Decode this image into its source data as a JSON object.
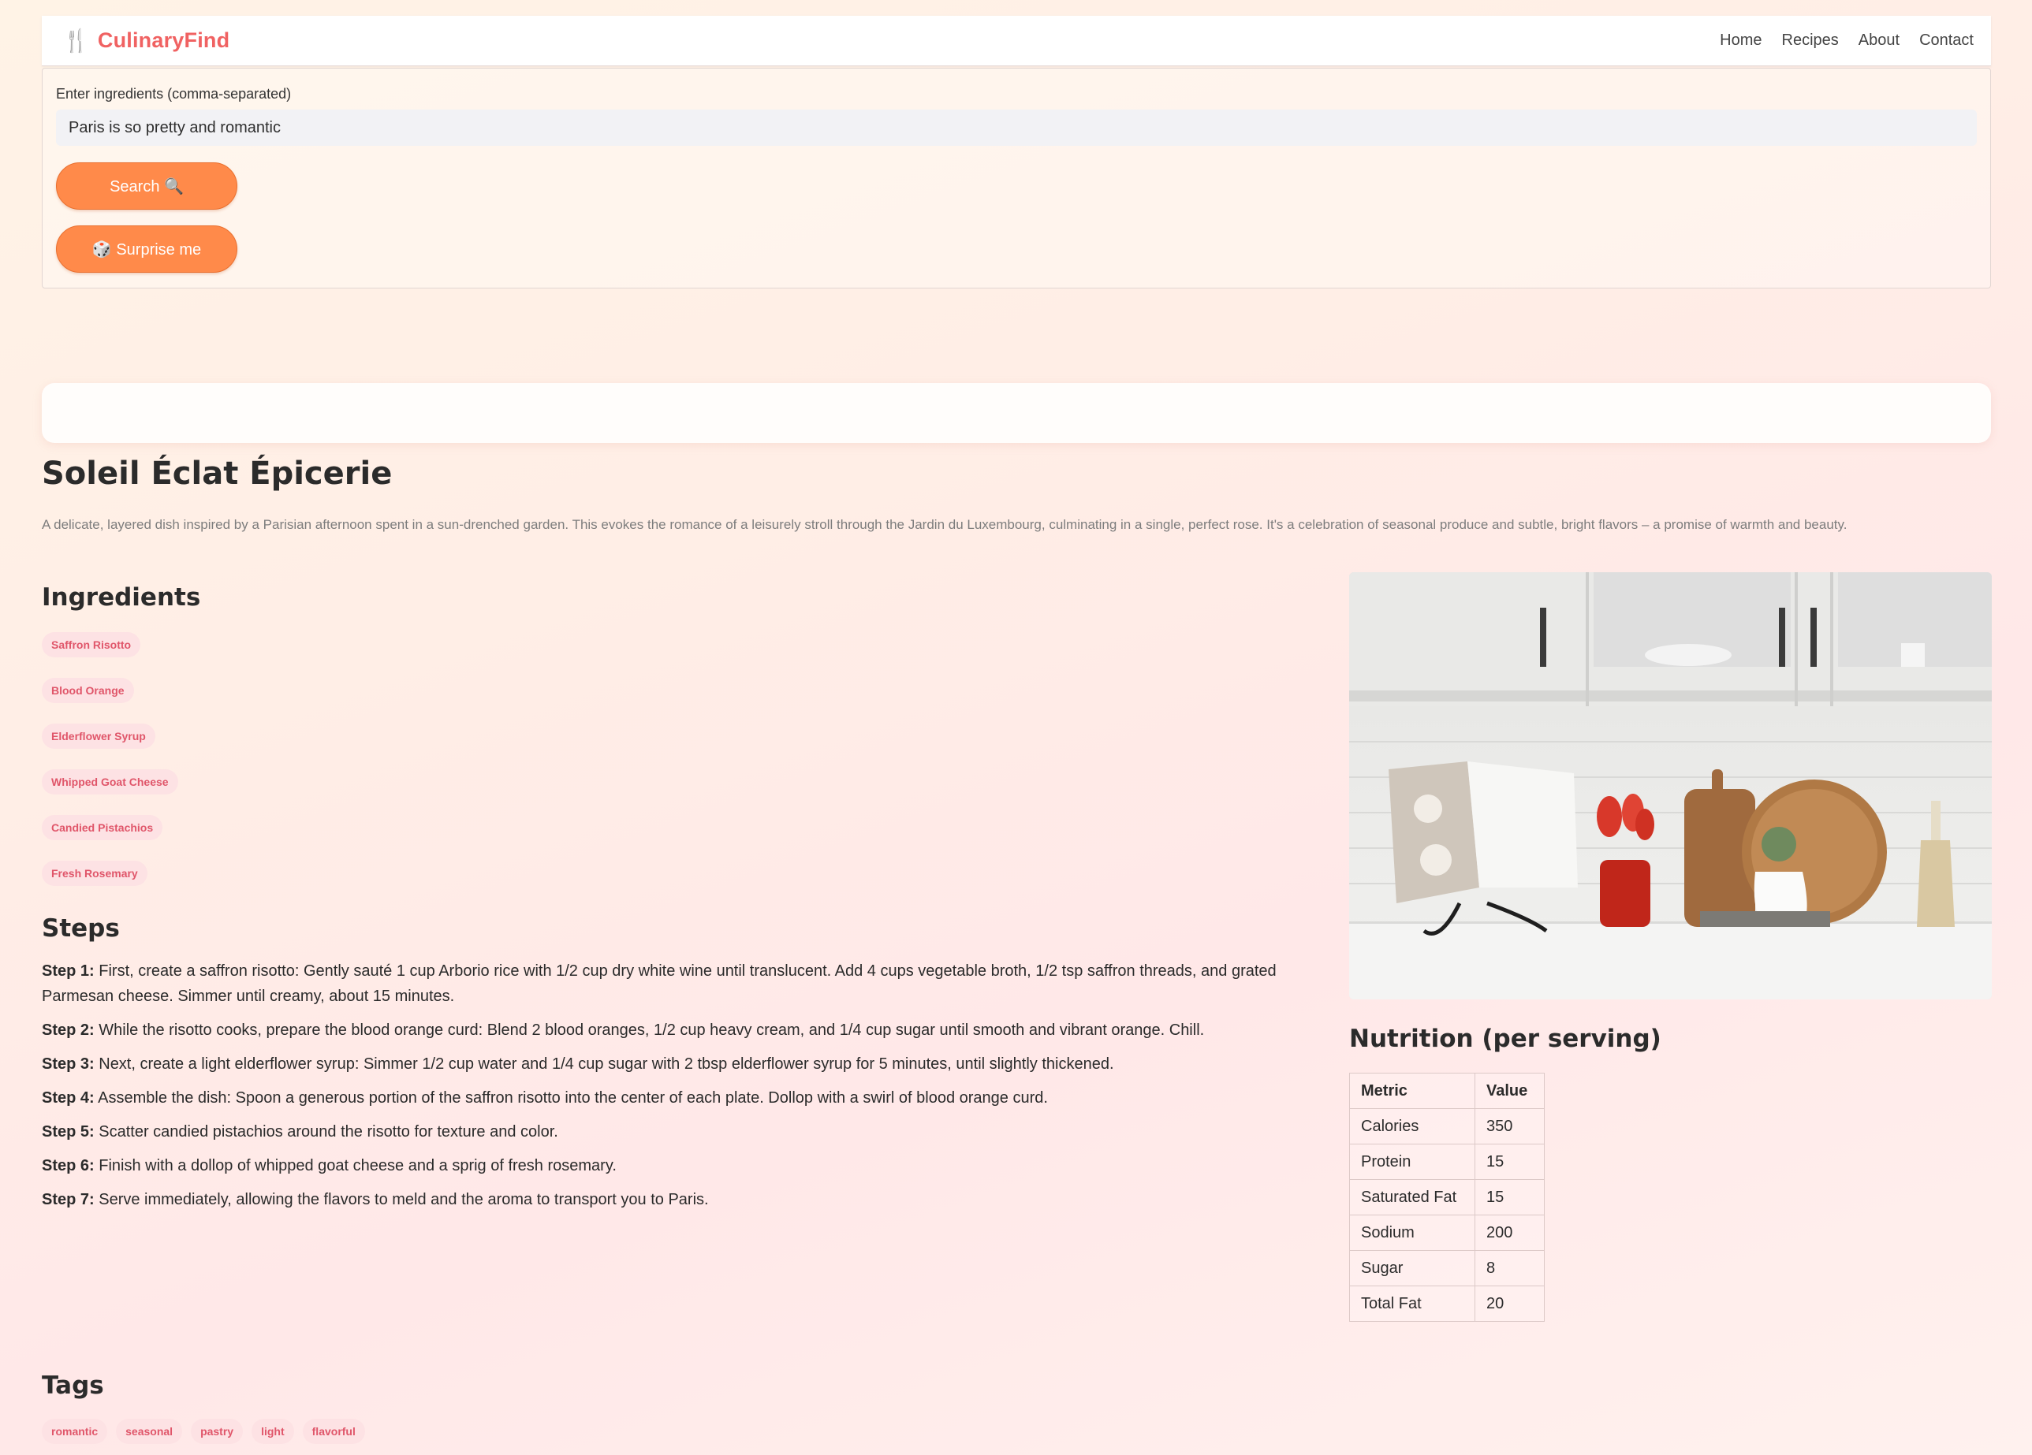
{
  "nav": {
    "brand": "CulinaryFind",
    "links": [
      "Home",
      "Recipes",
      "About",
      "Contact"
    ]
  },
  "search": {
    "label": "Enter ingredients (comma-separated)",
    "value": "Paris is so pretty and romantic",
    "search_button": "Search 🔍",
    "surprise_button": "🎲 Surprise me"
  },
  "recipe": {
    "title": "Soleil Éclat Épicerie",
    "description": "A delicate, layered dish inspired by a Parisian afternoon spent in a sun-drenched garden. This evokes the romance of a leisurely stroll through the Jardin du Luxembourg, culminating in a single, perfect rose. It's a celebration of seasonal produce and subtle, bright flavors – a promise of warmth and beauty.",
    "ingredients_heading": "Ingredients",
    "ingredients": [
      "Saffron Risotto",
      "Blood Orange",
      "Elderflower Syrup",
      "Whipped Goat Cheese",
      "Candied Pistachios",
      "Fresh Rosemary"
    ],
    "steps_heading": "Steps",
    "steps": [
      {
        "label": "Step 1:",
        "text": " First, create a saffron risotto: Gently sauté 1 cup Arborio rice with 1/2 cup dry white wine until translucent. Add 4 cups vegetable broth, 1/2 tsp saffron threads, and grated Parmesan cheese. Simmer until creamy, about 15 minutes."
      },
      {
        "label": "Step 2:",
        "text": " While the risotto cooks, prepare the blood orange curd: Blend 2 blood oranges, 1/2 cup heavy cream, and 1/4 cup sugar until smooth and vibrant orange. Chill."
      },
      {
        "label": "Step 3:",
        "text": " Next, create a light elderflower syrup: Simmer 1/2 cup water and 1/4 cup sugar with 2 tbsp elderflower syrup for 5 minutes, until slightly thickened."
      },
      {
        "label": "Step 4:",
        "text": " Assemble the dish: Spoon a generous portion of the saffron risotto into the center of each plate. Dollop with a swirl of blood orange curd."
      },
      {
        "label": "Step 5:",
        "text": " Scatter candied pistachios around the risotto for texture and color."
      },
      {
        "label": "Step 6:",
        "text": " Finish with a dollop of whipped goat cheese and a sprig of fresh rosemary."
      },
      {
        "label": "Step 7:",
        "text": " Serve immediately, allowing the flavors to meld and the aroma to transport you to Paris."
      }
    ],
    "nutrition_heading": "Nutrition (per serving)",
    "nutrition_headers": [
      "Metric",
      "Value"
    ],
    "nutrition": [
      [
        "Calories",
        "350"
      ],
      [
        "Protein",
        "15"
      ],
      [
        "Saturated Fat",
        "15"
      ],
      [
        "Sodium",
        "200"
      ],
      [
        "Sugar",
        "8"
      ],
      [
        "Total Fat",
        "20"
      ]
    ],
    "tags_heading": "Tags",
    "tags": [
      "romantic",
      "seasonal",
      "pastry",
      "light",
      "flavorful"
    ]
  },
  "colors": {
    "brand": "#f06262",
    "button": "#ff8a4a",
    "chip_bg": "#fde2e4",
    "chip_text": "#e0566a"
  },
  "icons": {
    "brand": "fork-knife-icon"
  }
}
